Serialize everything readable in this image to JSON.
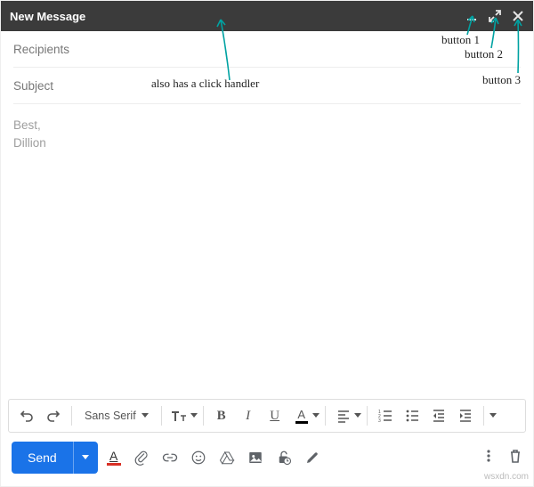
{
  "header": {
    "title": "New Message"
  },
  "fields": {
    "recipients_placeholder": "Recipients",
    "recipients_value": "",
    "subject_placeholder": "Subject",
    "subject_value": ""
  },
  "body": {
    "line_blank": " ",
    "signature_line1": "Best,",
    "signature_line2": "Dillion"
  },
  "toolbar": {
    "font_family_label": "Sans Serif",
    "bold_glyph": "B",
    "italic_glyph": "I",
    "underline_glyph": "U",
    "textcolor_letter": "A"
  },
  "footer": {
    "send_label": "Send",
    "textcolor_letter": "A"
  },
  "annotations": {
    "click_handler_note": "also has a click handler",
    "button1_label": "button 1",
    "button2_label": "button 2",
    "button3_label": "button 3"
  },
  "watermark": "wsxdn.com"
}
